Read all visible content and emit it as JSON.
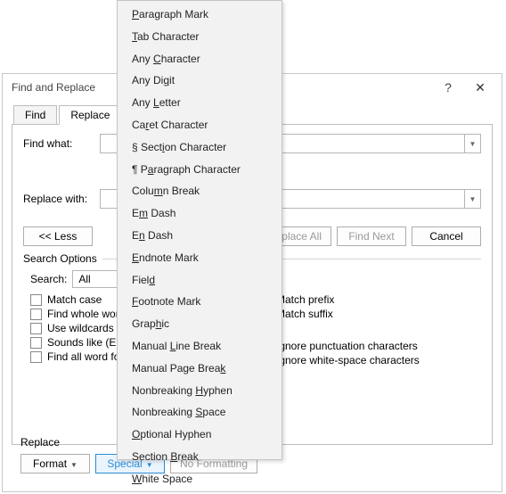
{
  "dialog": {
    "title": "Find and Replace",
    "tabs": {
      "find": "Find",
      "replace": "Replace"
    },
    "findWhatLabel": "Find what:",
    "replaceWithLabel": "Replace with:",
    "buttons": {
      "less": "<< Less",
      "replaceAll": "Replace All",
      "findNext": "Find Next",
      "cancel": "Cancel"
    },
    "searchOptionsTitle": "Search Options",
    "searchLabel": "Search:",
    "searchValue": "All",
    "checks": {
      "matchCase": "Match case",
      "wholeWords": "Find whole words only",
      "wildcards": "Use wildcards",
      "soundsLike": "Sounds like (English)",
      "wordForms": "Find all word forms (English)",
      "matchPrefix": "Match prefix",
      "matchSuffix": "Match suffix",
      "ignorePunct": "Ignore punctuation characters",
      "ignoreWhite": "Ignore white-space characters"
    },
    "bottom": {
      "sectionLabel": "Replace",
      "format": "Format",
      "special": "Special",
      "noFormatting": "No Formatting"
    }
  },
  "menu": {
    "items": [
      {
        "pre": "",
        "u": "P",
        "post": "aragraph Mark"
      },
      {
        "pre": "",
        "u": "T",
        "post": "ab Character"
      },
      {
        "pre": "Any ",
        "u": "C",
        "post": "haracter"
      },
      {
        "pre": "Any Di",
        "u": "g",
        "post": "it"
      },
      {
        "pre": "Any ",
        "u": "L",
        "post": "etter"
      },
      {
        "pre": "Ca",
        "u": "r",
        "post": "et Character"
      },
      {
        "pre": "§ Sect",
        "u": "i",
        "post": "on Character"
      },
      {
        "pre": "¶ P",
        "u": "a",
        "post": "ragraph Character"
      },
      {
        "pre": "Colu",
        "u": "m",
        "post": "n Break"
      },
      {
        "pre": "E",
        "u": "m",
        "post": " Dash"
      },
      {
        "pre": "E",
        "u": "n",
        "post": " Dash"
      },
      {
        "pre": "",
        "u": "E",
        "post": "ndnote Mark"
      },
      {
        "pre": "Fiel",
        "u": "d",
        "post": ""
      },
      {
        "pre": "",
        "u": "F",
        "post": "ootnote Mark"
      },
      {
        "pre": "Grap",
        "u": "h",
        "post": "ic"
      },
      {
        "pre": "Manual ",
        "u": "L",
        "post": "ine Break"
      },
      {
        "pre": "Manual Page Brea",
        "u": "k",
        "post": ""
      },
      {
        "pre": "Nonbreaking ",
        "u": "H",
        "post": "yphen"
      },
      {
        "pre": "Nonbreaking ",
        "u": "S",
        "post": "pace"
      },
      {
        "pre": "",
        "u": "O",
        "post": "ptional Hyphen"
      },
      {
        "pre": "Section ",
        "u": "B",
        "post": "reak"
      },
      {
        "pre": "",
        "u": "W",
        "post": "hite Space"
      }
    ]
  }
}
